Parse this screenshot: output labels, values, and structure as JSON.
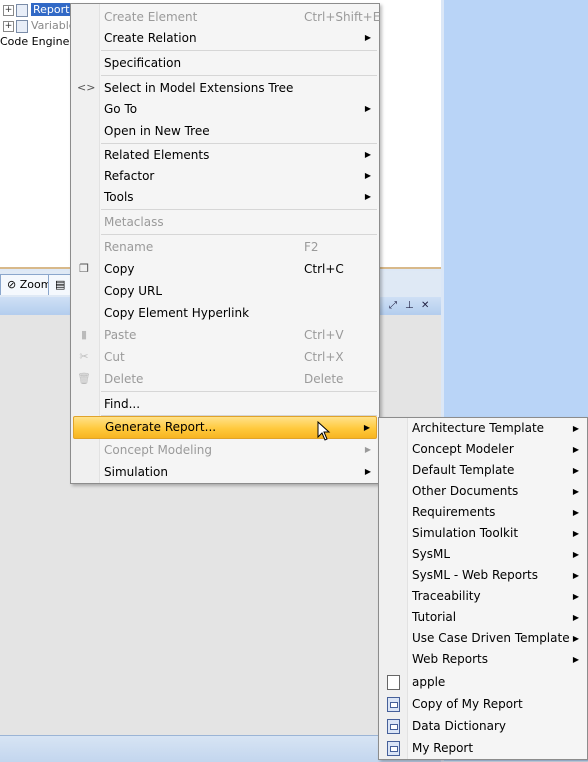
{
  "tree": {
    "rows": [
      {
        "label": "Report",
        "selected": true
      },
      {
        "label": "Variable",
        "selected": false
      },
      {
        "label": "Code Engineer",
        "selected": false
      }
    ]
  },
  "tabs": [
    {
      "label": "Zoom"
    }
  ],
  "context_menu": {
    "items": [
      {
        "label": "Create Element",
        "shortcut": "Ctrl+Shift+E",
        "disabled": true
      },
      {
        "label": "Create Relation",
        "submenu": true
      },
      {
        "label": "Specification"
      },
      {
        "label": "Select in Model Extensions Tree",
        "icon": "<>"
      },
      {
        "label": "Go To",
        "submenu": true
      },
      {
        "label": "Open in New Tree"
      },
      {
        "label": "Related Elements",
        "submenu": true
      },
      {
        "label": "Refactor",
        "submenu": true
      },
      {
        "label": "Tools",
        "submenu": true
      },
      {
        "label": "Metaclass",
        "disabled": true
      },
      {
        "label": "Rename",
        "shortcut": "F2",
        "disabled": true
      },
      {
        "label": "Copy",
        "shortcut": "Ctrl+C"
      },
      {
        "label": "Copy URL"
      },
      {
        "label": "Copy Element Hyperlink"
      },
      {
        "label": "Paste",
        "shortcut": "Ctrl+V",
        "disabled": true
      },
      {
        "label": "Cut",
        "shortcut": "Ctrl+X",
        "disabled": true
      },
      {
        "label": "Delete",
        "shortcut": "Delete",
        "disabled": true
      },
      {
        "label": "Find..."
      },
      {
        "label": "Generate Report...",
        "submenu": true,
        "highlighted": true
      },
      {
        "label": "Concept Modeling",
        "submenu": true,
        "disabled": true
      },
      {
        "label": "Simulation",
        "submenu": true
      }
    ]
  },
  "report_submenu": {
    "items": [
      {
        "label": "Architecture Template"
      },
      {
        "label": "Concept Modeler"
      },
      {
        "label": "Default Template"
      },
      {
        "label": "Other Documents"
      },
      {
        "label": "Requirements"
      },
      {
        "label": "Simulation Toolkit"
      },
      {
        "label": "SysML"
      },
      {
        "label": "SysML - Web Reports"
      },
      {
        "label": "Traceability"
      },
      {
        "label": "Tutorial"
      },
      {
        "label": "Use Case Driven Template"
      },
      {
        "label": "Web Reports"
      },
      {
        "label": "apple"
      },
      {
        "label": "Copy of My Report"
      },
      {
        "label": "Data Dictionary"
      },
      {
        "label": "My Report"
      }
    ]
  },
  "colors": {
    "highlight": "#ffc93d",
    "selection": "#3169c6",
    "background_blue": "#b9d4f7"
  }
}
